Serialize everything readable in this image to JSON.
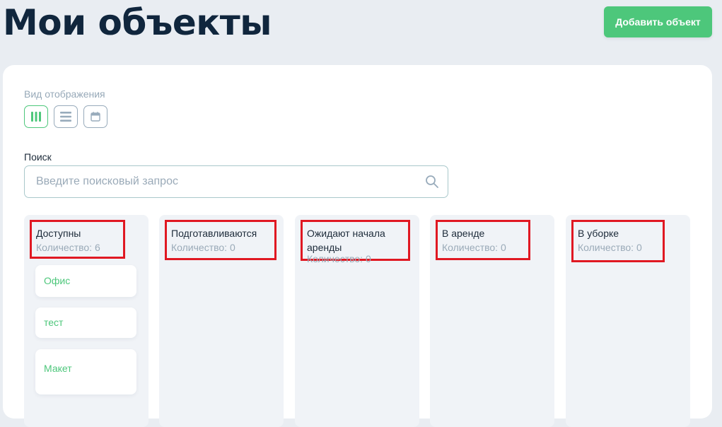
{
  "header": {
    "title": "Мои объекты",
    "add_button_label": "Добавить объект"
  },
  "view": {
    "label": "Вид отображения",
    "modes": [
      {
        "name": "columns",
        "icon": "columns-icon",
        "active": true
      },
      {
        "name": "list",
        "icon": "list-icon",
        "active": false
      },
      {
        "name": "calendar",
        "icon": "calendar-icon",
        "active": false
      }
    ]
  },
  "search": {
    "label": "Поиск",
    "placeholder": "Введите поисковый запрос"
  },
  "columns": [
    {
      "title": "Доступны",
      "count": "Количество: 6",
      "items": [
        "Офис",
        "тест",
        "Макет"
      ]
    },
    {
      "title": "Подготавливаются",
      "count": "Количество: 0",
      "items": []
    },
    {
      "title": "Ожидают начала аренды",
      "count": "Количество: 0",
      "items": []
    },
    {
      "title": "В аренде",
      "count": "Количество: 0",
      "items": []
    },
    {
      "title": "В уборке",
      "count": "Количество: 0",
      "items": []
    }
  ],
  "colors": {
    "accent": "#4dc77b",
    "highlight_border": "#e01822",
    "title": "#10263d",
    "page_bg": "#e9edf2"
  }
}
